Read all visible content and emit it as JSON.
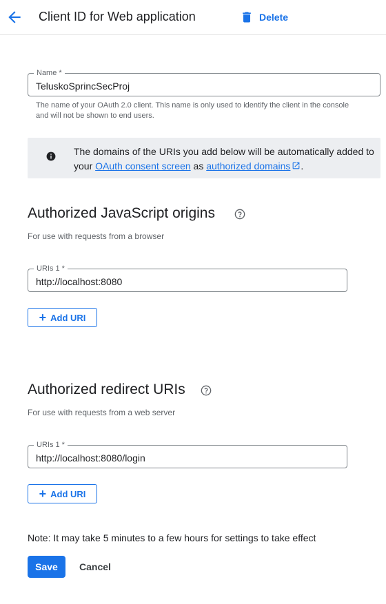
{
  "header": {
    "back_icon": "arrow-back-icon",
    "title": "Client ID for Web application",
    "delete_icon": "trash-icon",
    "delete_label": "Delete"
  },
  "name_field": {
    "label": "Name *",
    "value": "TeluskoSprincSecProj",
    "helper": "The name of your OAuth 2.0 client. This name is only used to identify the client in the console and will not be shown to end users."
  },
  "info": {
    "icon": "info-icon",
    "text_before": "The domains of the URIs you add below will be automatically added to your ",
    "link1": "OAuth consent screen",
    "text_mid": " as ",
    "link2": "authorized domains",
    "external_icon": "external-link-icon",
    "text_after": "."
  },
  "js_origins": {
    "title": "Authorized JavaScript origins",
    "help_icon": "help-circle-icon",
    "subtitle": "For use with requests from a browser",
    "uri_label": "URIs 1 *",
    "uri_value": "http://localhost:8080",
    "add_label": "Add URI"
  },
  "redirect_uris": {
    "title": "Authorized redirect URIs",
    "help_icon": "help-circle-icon",
    "subtitle": "For use with requests from a web server",
    "uri_label": "URIs 1 *",
    "uri_value": "http://localhost:8080/login",
    "add_label": "Add URI"
  },
  "footer": {
    "note": "Note: It may take 5 minutes to a few hours for settings to take effect",
    "save_label": "Save",
    "cancel_label": "Cancel"
  },
  "colors": {
    "accent": "#1a73e8",
    "info_bg": "#eceef1"
  }
}
